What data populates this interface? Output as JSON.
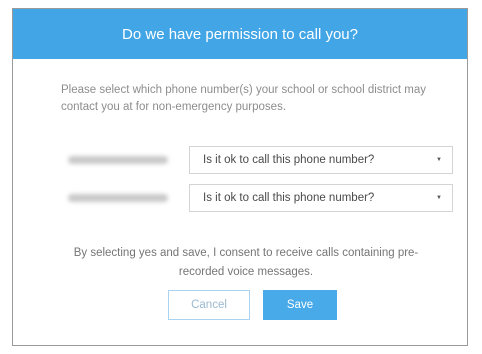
{
  "dialog": {
    "title": "Do we have permission to call you?",
    "intro": "Please select which phone number(s) your school or school district may contact you at for non-emergency purposes.",
    "phones": [
      {
        "select_value": "Is it ok to call this phone number?"
      },
      {
        "select_value": "Is it ok to call this phone number?"
      }
    ],
    "consent": "By selecting yes and save, I consent to receive calls containing pre-recorded voice messages.",
    "cancel_label": "Cancel",
    "save_label": "Save"
  },
  "colors": {
    "header": "#42a5e6",
    "save_button": "#49aaea",
    "cancel_border": "#a9d3f0"
  },
  "icons": {
    "select_caret": "chevron-down-icon"
  }
}
